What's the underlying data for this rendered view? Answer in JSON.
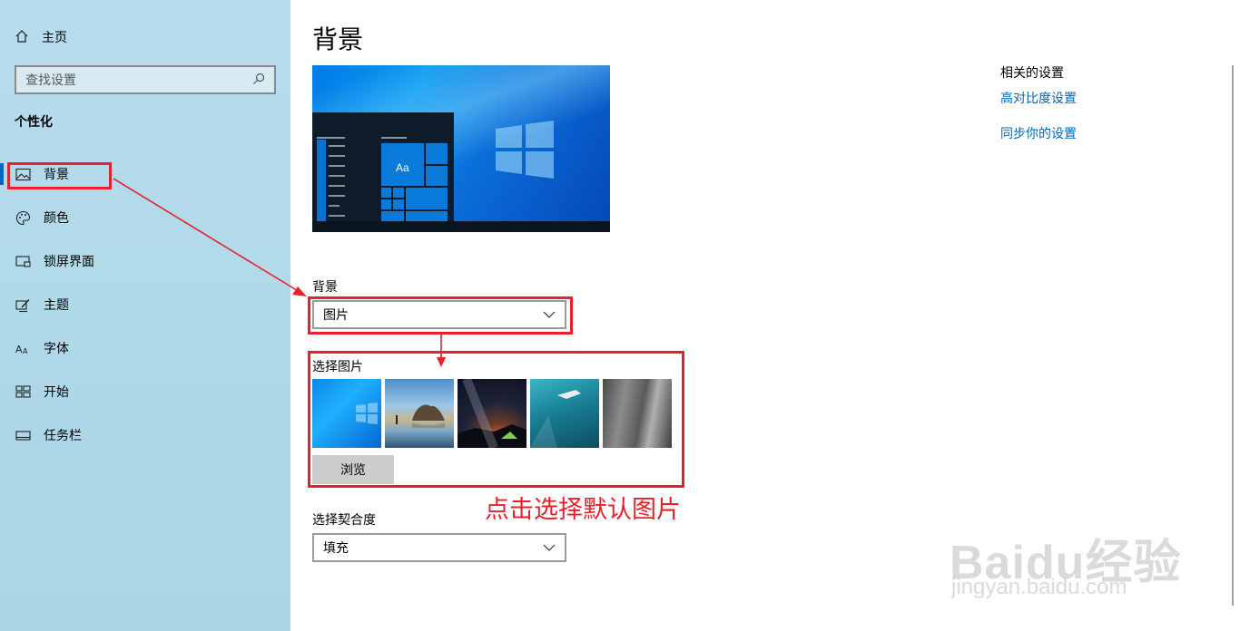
{
  "sidebar": {
    "home_label": "主页",
    "search_placeholder": "查找设置",
    "section_title": "个性化",
    "items": [
      {
        "label": "背景",
        "icon": "picture-icon"
      },
      {
        "label": "颜色",
        "icon": "palette-icon"
      },
      {
        "label": "锁屏界面",
        "icon": "lock-screen-icon"
      },
      {
        "label": "主题",
        "icon": "theme-brush-icon"
      },
      {
        "label": "字体",
        "icon": "font-icon"
      },
      {
        "label": "开始",
        "icon": "start-tiles-icon"
      },
      {
        "label": "任务栏",
        "icon": "taskbar-icon"
      }
    ]
  },
  "main": {
    "page_title": "背景",
    "preview_tile_label": "Aa",
    "background_label": "背景",
    "background_value": "图片",
    "choose_picture_label": "选择图片",
    "browse_label": "浏览",
    "fit_label": "选择契合度",
    "fit_value": "填充"
  },
  "related": {
    "title": "相关的设置",
    "links": [
      "高对比度设置",
      "同步你的设置"
    ]
  },
  "annotation": {
    "text": "点击选择默认图片"
  },
  "watermark": {
    "main": "Baidu经验",
    "sub": "jingyan.baidu.com"
  },
  "colors": {
    "accent": "#0067c0",
    "annotation_red": "#e8202a",
    "sidebar_bg": "#b0d9ea"
  }
}
